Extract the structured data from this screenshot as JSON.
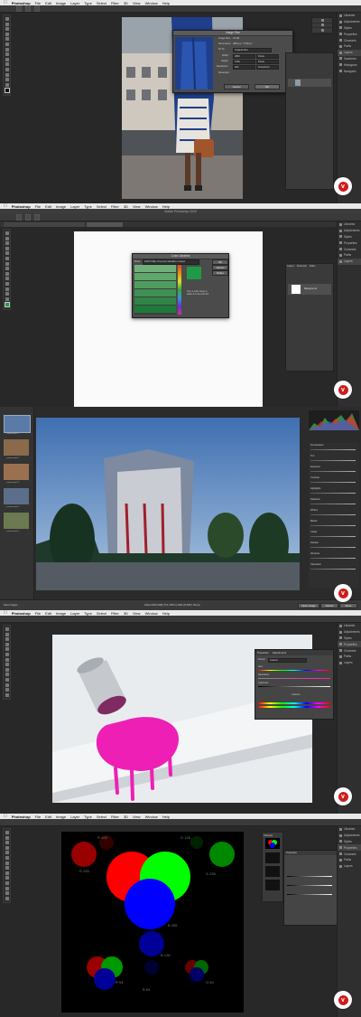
{
  "menubar": {
    "app_name": "Photoshop",
    "items": [
      "File",
      "Edit",
      "Image",
      "Layer",
      "Type",
      "Select",
      "Filter",
      "3D",
      "View",
      "Window",
      "Help"
    ]
  },
  "dock_items": [
    "Libraries",
    "Adjustments",
    "Styles",
    "Properties",
    "Channels",
    "Paths",
    "Layers",
    "Swatches",
    "Histogram",
    "Navigator"
  ],
  "panel1": {
    "dialog_title": "Image Size",
    "image_size_label": "Image Size:",
    "image_size_value": "31.1M",
    "dimensions_label": "Dimensions:",
    "dimensions_value": "3840 px × 5760 px",
    "fit_to_label": "Fit To:",
    "fit_to_value": "Original Size",
    "width_label": "Width:",
    "width_value": "3840",
    "width_unit": "Pixels",
    "height_label": "Height:",
    "height_value": "5760",
    "height_unit": "Pixels",
    "resolution_label": "Resolution:",
    "resolution_value": "300",
    "resolution_unit": "Pixels/Inch",
    "resample_label": "Resample:",
    "cancel_label": "Cancel",
    "ok_label": "OK"
  },
  "panel2": {
    "window_title": "Adobe Photoshop 2020",
    "dialog_title": "Color Libraries",
    "book_label": "Book:",
    "book_value": "PANTONE+ Premium Metallics Coated",
    "ok_label": "OK",
    "cancel_label": "Cancel",
    "picker_label": "Picker",
    "hint_text": "Type a color name to select it in the color list.",
    "swatches": [
      "#6fb07a",
      "#5ea86a",
      "#4f9d5e",
      "#3f9052",
      "#2f8446",
      "#1f7a3a"
    ],
    "selected_color": "#1f9a47",
    "layer_name": "Background",
    "layer_tabs": [
      "Layers",
      "Channels",
      "Paths"
    ]
  },
  "panel3": {
    "thumbs": [
      "_camera-raw-1",
      "_camera-raw-2",
      "_camera-raw-3",
      "_camera-raw-4",
      "_camera-raw-5"
    ],
    "status_left": "Save Images...",
    "status_mid": "Adobe RGB (1998); 8 bit; 6000 by 4000 (24.0MP); 300 ppi",
    "open_image": "Open Image",
    "cancel": "Cancel",
    "done": "Done",
    "zoom": "Fit in View",
    "sliders": [
      "Temperature",
      "Tint",
      "Exposure",
      "Contrast",
      "Highlights",
      "Shadows",
      "Whites",
      "Blacks",
      "Clarity",
      "Dehaze",
      "Vibrance",
      "Saturation"
    ]
  },
  "panel4": {
    "properties_tabs": [
      "Properties",
      "Adjustments"
    ],
    "preset_label": "Preset:",
    "preset_value": "Custom",
    "hue_label": "Hue:",
    "saturation_label": "Saturation:",
    "lightness_label": "Lightness:",
    "colorize_label": "Colorize"
  },
  "panel5": {
    "circle_labels": [
      "R 255",
      "G 255",
      "B 255",
      "R 128",
      "G 128",
      "B 128",
      "R 64",
      "G 64",
      "B 64"
    ],
    "layers_title": "Channels",
    "properties_title": "Properties"
  },
  "colors": {
    "accent_red": "#cc1d1d",
    "ps_dark": "#282828",
    "ps_menubar": "#e9e9e9"
  }
}
